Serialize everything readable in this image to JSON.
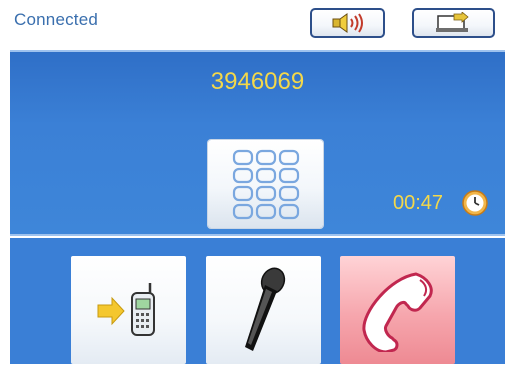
{
  "status": {
    "text": "Connected"
  },
  "toolbar": {
    "speaker_icon": "speaker-icon",
    "transfer_icon": "transfer-to-handset-icon"
  },
  "call": {
    "number": "3946069",
    "duration": "00:47",
    "keypad_icon": "keypad-icon",
    "clock_icon": "clock-icon"
  },
  "actions": {
    "handover_icon": "handover-to-phone-icon",
    "mute_icon": "microphone-icon",
    "hangup_icon": "hang-up-icon"
  },
  "colors": {
    "panel_blue": "#3b80d6",
    "accent_yellow": "#f4d84a",
    "status_text": "#3a6fae",
    "hangup_red": "#ee8a93"
  }
}
